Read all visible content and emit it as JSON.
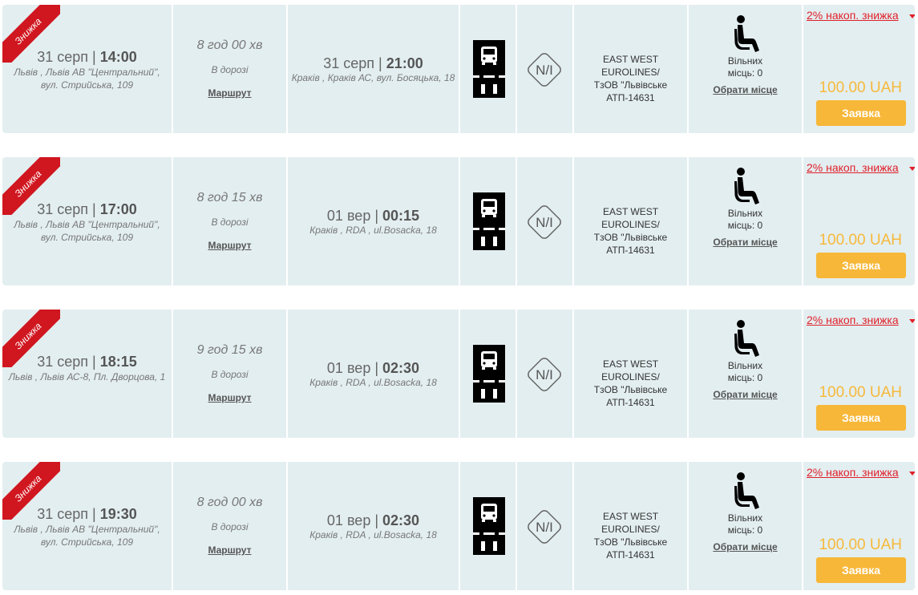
{
  "trips": [
    {
      "ribbon": "Знижка",
      "departure": {
        "date": "31 серп",
        "time": "14:00",
        "address": "Львів , Львів АВ \"Центральний\", вул. Стрийська, 109"
      },
      "duration": "8 год 00 хв",
      "road_label": "В дорозі",
      "route_link": "Маршрут",
      "arrival": {
        "date": "31 серп",
        "time": "21:00",
        "address": "Краків , Краків АС, вул. Босяцька, 18"
      },
      "ni_label": "N/I",
      "carrier": [
        "EAST WEST EUROLINES/",
        "ТзОВ \"Львівське",
        "АТП-14631"
      ],
      "seats_label": "Вільних",
      "seats_value": "місць: 0",
      "choose_seat": "Обрати місце",
      "discount": "2% накоп. знижка",
      "price": "100.00 UAH",
      "order_button": "Заявка"
    },
    {
      "ribbon": "Знижка",
      "departure": {
        "date": "31 серп",
        "time": "17:00",
        "address": "Львів , Львів АВ \"Центральний\", вул. Стрийська, 109"
      },
      "duration": "8 год 15 хв",
      "road_label": "В дорозі",
      "route_link": "Маршрут",
      "arrival": {
        "date": "01 вер",
        "time": "00:15",
        "address": "Краків , RDA , ul.Bosacka, 18"
      },
      "ni_label": "N/I",
      "carrier": [
        "EAST WEST EUROLINES/",
        "ТзОВ \"Львівське",
        "АТП-14631"
      ],
      "seats_label": "Вільних",
      "seats_value": "місць: 0",
      "choose_seat": "Обрати місце",
      "discount": "2% накоп. знижка",
      "price": "100.00 UAH",
      "order_button": "Заявка"
    },
    {
      "ribbon": "Знижка",
      "departure": {
        "date": "31 серп",
        "time": "18:15",
        "address": "Львів , Львів АС-8, Пл. Дворцова, 1"
      },
      "duration": "9 год 15 хв",
      "road_label": "В дорозі",
      "route_link": "Маршрут",
      "arrival": {
        "date": "01 вер",
        "time": "02:30",
        "address": "Краків , RDA , ul.Bosacka, 18"
      },
      "ni_label": "N/I",
      "carrier": [
        "EAST WEST EUROLINES/",
        "ТзОВ \"Львівське",
        "АТП-14631"
      ],
      "seats_label": "Вільних",
      "seats_value": "місць: 0",
      "choose_seat": "Обрати місце",
      "discount": "2% накоп. знижка",
      "price": "100.00 UAH",
      "order_button": "Заявка"
    },
    {
      "ribbon": "Знижка",
      "departure": {
        "date": "31 серп",
        "time": "19:30",
        "address": "Львів , Львів АВ \"Центральний\", вул. Стрийська, 109"
      },
      "duration": "8 год 00 хв",
      "road_label": "В дорозі",
      "route_link": "Маршрут",
      "arrival": {
        "date": "01 вер",
        "time": "02:30",
        "address": "Краків , RDA , ul.Bosacka, 18"
      },
      "ni_label": "N/I",
      "carrier": [
        "EAST WEST EUROLINES/",
        "ТзОВ \"Львівське",
        "АТП-14631"
      ],
      "seats_label": "Вільних",
      "seats_value": "місць: 0",
      "choose_seat": "Обрати місце",
      "discount": "2% накоп. знижка",
      "price": "100.00 UAH",
      "order_button": "Заявка"
    }
  ],
  "icons": {
    "ribbon": "discount-ribbon",
    "bus": "bus-road-icon",
    "ni": "ni-diamond-icon",
    "seat": "seated-person-icon",
    "caret": "caret-down-icon"
  },
  "colors": {
    "row_background": "#e3eef0",
    "ribbon": "#d0161f",
    "discount_link": "#e0202a",
    "price": "#f6b93b",
    "order_button": "#f7b738"
  }
}
